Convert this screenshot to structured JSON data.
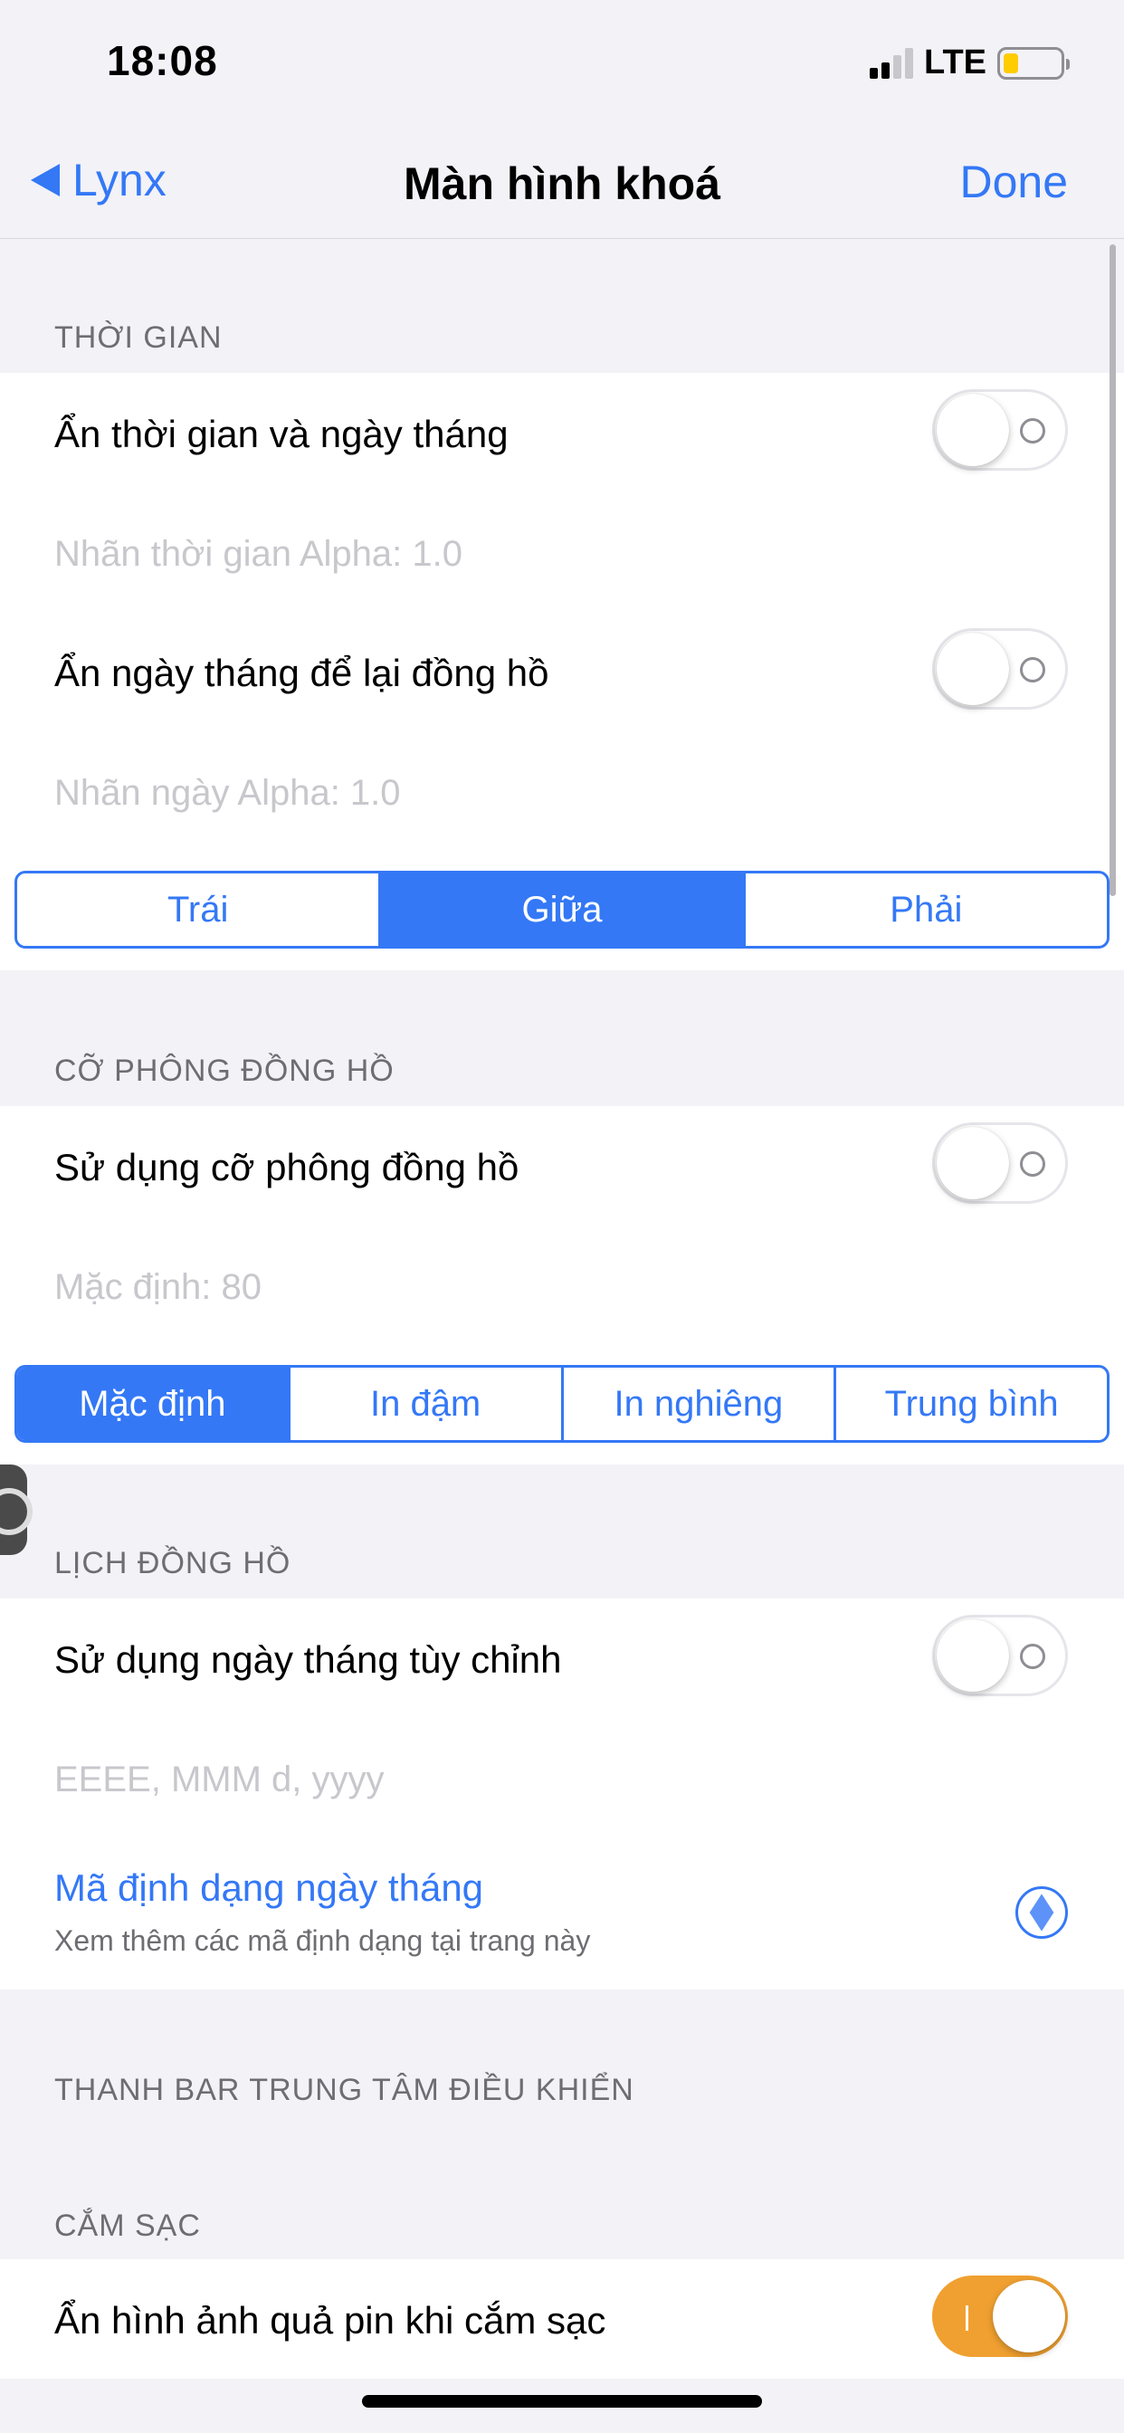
{
  "status_bar": {
    "time": "18:08",
    "network": "LTE",
    "battery_level": 0.26
  },
  "nav": {
    "back_label": "Lynx",
    "title": "Màn hình khoá",
    "done_label": "Done"
  },
  "sections": {
    "time": {
      "header": "THỜI GIAN",
      "hide_time_date": {
        "label": "Ẩn thời gian và ngày tháng",
        "on": false
      },
      "time_label_alpha": "Nhãn thời gian Alpha: 1.0",
      "hide_date_keep_clock": {
        "label": "Ẩn ngày tháng để lại đồng hồ",
        "on": false
      },
      "date_label_alpha": "Nhãn ngày Alpha: 1.0",
      "alignment": {
        "options": [
          "Trái",
          "Giữa",
          "Phải"
        ],
        "selected": "Giữa"
      }
    },
    "clock_font": {
      "header": "CỠ PHÔNG ĐỒNG HỒ",
      "use_clock_font_size": {
        "label": "Sử dụng cỡ phông đồng hồ",
        "on": false
      },
      "default_value": "Mặc định: 80",
      "weight": {
        "options": [
          "Mặc định",
          "In đậm",
          "In nghiêng",
          "Trung bình"
        ],
        "selected": "Mặc định"
      }
    },
    "clock_calendar": {
      "header": "LỊCH ĐỒNG HỒ",
      "use_custom_date": {
        "label": "Sử dụng ngày tháng tùy chỉnh",
        "on": false
      },
      "format_placeholder": "EEEE, MMM d, yyyy",
      "format_link": {
        "title": "Mã định dạng ngày tháng",
        "subtitle": "Xem thêm các mã định dạng tại trang này"
      }
    },
    "control_center": {
      "header": "THANH BAR TRUNG TÂM ĐIỀU KHIỂN"
    },
    "charging": {
      "header": "CẮM SẠC",
      "hide_battery_image": {
        "label": "Ẩn hình ảnh quả pin khi cắm sạc",
        "on": true
      }
    }
  },
  "colors": {
    "accent": "#3478f6",
    "toggle_on": "#f0a030",
    "background": "#f2f2f7"
  }
}
